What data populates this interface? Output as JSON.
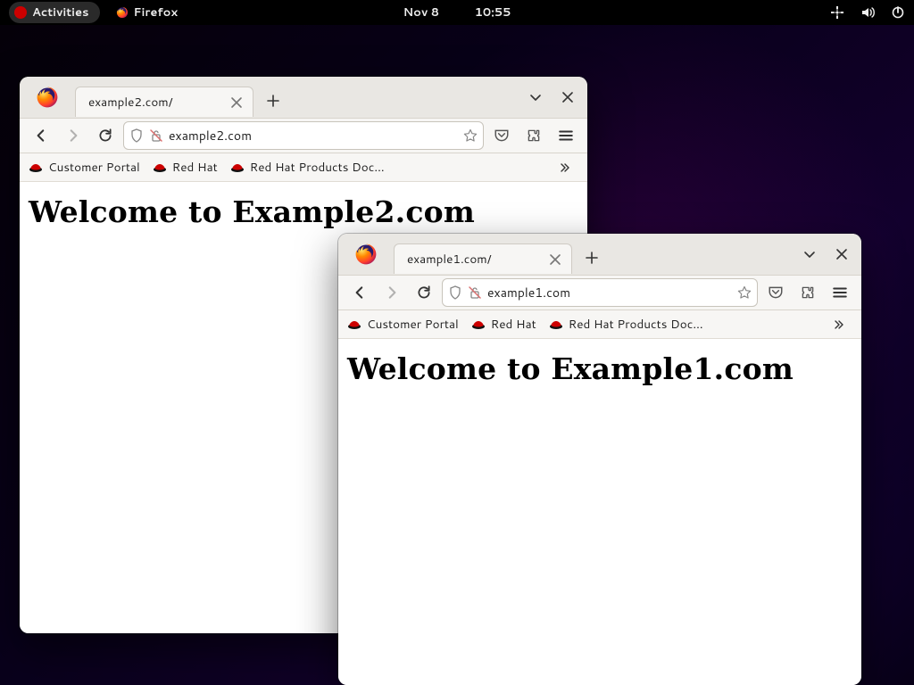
{
  "topbar": {
    "activities": "Activities",
    "app_name": "Firefox",
    "date": "Nov 8",
    "time": "10:55"
  },
  "bookmarks": [
    {
      "label": "Customer Portal"
    },
    {
      "label": "Red Hat"
    },
    {
      "label": "Red Hat Products Doc…"
    }
  ],
  "windows": {
    "w2": {
      "tab_title": "example2.com/",
      "url": "example2.com",
      "heading": "Welcome to Example2.com"
    },
    "w1": {
      "tab_title": "example1.com/",
      "url": "example1.com",
      "heading": "Welcome to Example1.com"
    }
  }
}
